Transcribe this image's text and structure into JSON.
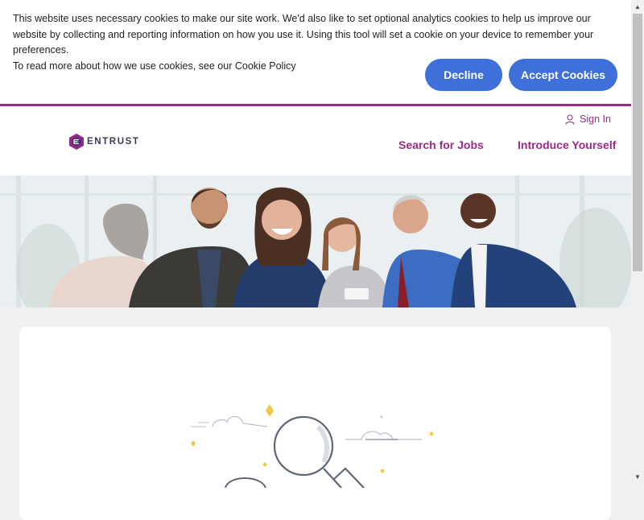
{
  "cookie_banner": {
    "line1": "This website uses necessary cookies to make our site work. We'd also like to set optional analytics cookies to help us improve our website by collecting and reporting information on how you use it. Using this tool will set a cookie on your device to remember your preferences.",
    "line2_prefix": "To read more about how we use cookies, see our",
    "policy_link": "Cookie Policy",
    "decline_label": "Decline",
    "accept_label": "Accept Cookies"
  },
  "header": {
    "logo_text": "ENTRUST",
    "signin_label": "Sign In",
    "nav": [
      "Search for Jobs",
      "Introduce Yourself"
    ]
  },
  "colors": {
    "brand": "#9b2a88",
    "button": "#3f6fd8",
    "page_bg": "#f0f1f3"
  },
  "icons": [
    "user-icon",
    "entrust-logo-icon",
    "magnifier-illustration",
    "sparkle-icon"
  ]
}
